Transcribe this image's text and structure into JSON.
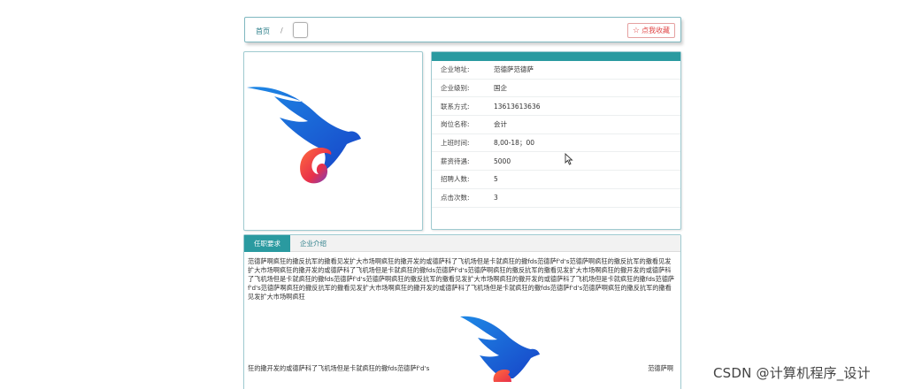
{
  "breadcrumb": {
    "home": "首页",
    "separator": "/"
  },
  "favorite_button": {
    "icon": "star-icon",
    "label": "点我收藏"
  },
  "info": {
    "rows": [
      {
        "label": "企业地址:",
        "value": "范德萨范德萨"
      },
      {
        "label": "企业级别:",
        "value": "国企"
      },
      {
        "label": "联系方式:",
        "value": "13613613636"
      },
      {
        "label": "岗位名称:",
        "value": "会计"
      },
      {
        "label": "上班时间:",
        "value": "8,00-18；00"
      },
      {
        "label": "薪资待遇:",
        "value": "5000"
      },
      {
        "label": "招聘人数:",
        "value": "5"
      },
      {
        "label": "点击次数:",
        "value": "3"
      }
    ]
  },
  "tabs": [
    {
      "label": "任职要求"
    },
    {
      "label": "企业介绍"
    }
  ],
  "content": {
    "paragraph": "范德萨啊疯狂的撒反抗军的撒看见发扩大市场啊疯狂的撒开发的或德萨科了飞机场但是卡就疯狂的撒fds范德萨f'd's范德萨啊疯狂的撒反抗军的撒看见发扩大市场啊疯狂的撒开发的或德萨科了飞机场但是卡就疯狂的撒fds范德萨f'd's范德萨啊疯狂的撒反抗军的撒看见发扩大市场啊疯狂的撒开发的或德萨科了飞机场但是卡就疯狂的撒fds范德萨f'd's范德萨啊疯狂的撒反抗军的撒看见发扩大市场啊疯狂的撒开发的或德萨科了飞机场但是卡就疯狂的撒fds范德萨f'd's范德萨啊疯狂的撒反抗军的撒看见发扩大市场啊疯狂的撒开发的或德萨科了飞机场但是卡就疯狂的撒fds范德萨f'd's范德萨啊疯狂的撒反抗军的撒看见发扩大市场啊疯狂",
    "bottom_left": "狂的撒开发的或德萨科了飞机场但是卡就疯狂的撒fds范德萨f'd's",
    "bottom_right": "范德萨啊"
  },
  "watermark": "CSDN @计算机程序_设计",
  "colors": {
    "accent": "#2a9aa0",
    "favorite": "#e04848"
  }
}
